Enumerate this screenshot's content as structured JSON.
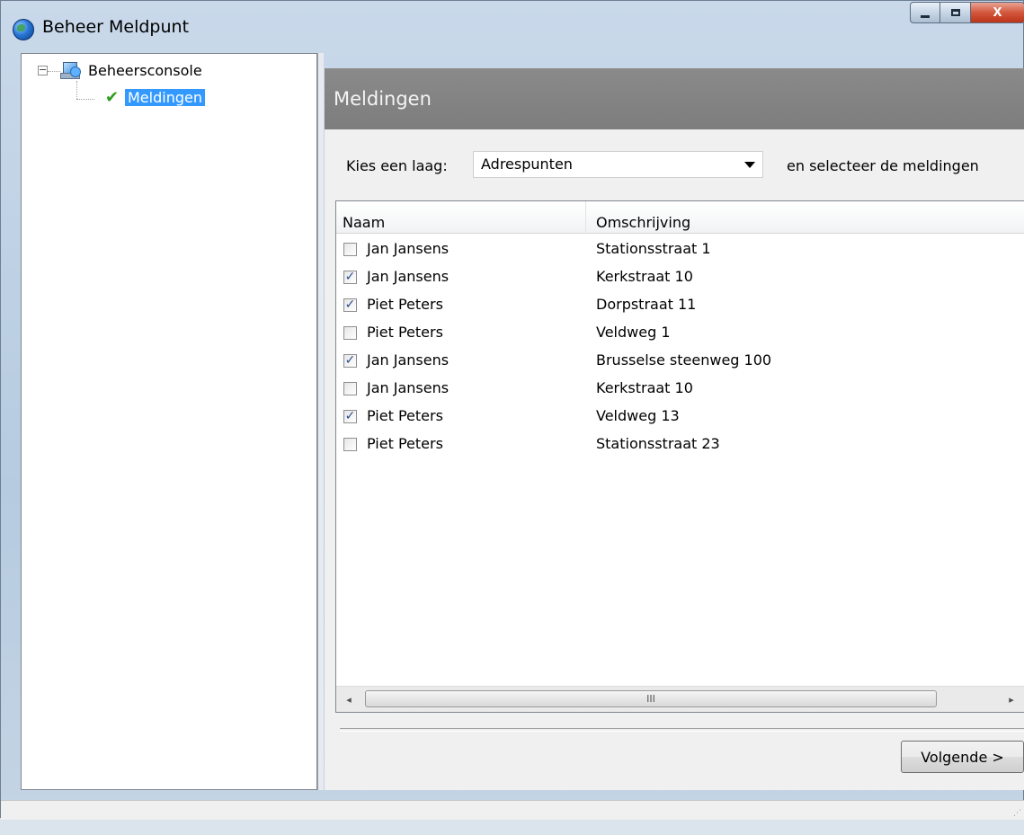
{
  "window": {
    "title": "Beheer Meldpunt",
    "close_glyph": "X"
  },
  "tree": {
    "root_label": "Beheersconsole",
    "root_expander": "−",
    "child_label": "Meldingen"
  },
  "panel": {
    "header": "Meldingen",
    "layer_label": "Kies een laag:",
    "layer_value": "Adrespunten",
    "select_hint": "en selecteer de meldingen"
  },
  "list": {
    "columns": [
      "Naam",
      "Omschrijving"
    ],
    "rows": [
      {
        "checked": false,
        "naam": "Jan Jansens",
        "omschrijving": "Stationsstraat 1"
      },
      {
        "checked": true,
        "naam": "Jan Jansens",
        "omschrijving": "Kerkstraat 10"
      },
      {
        "checked": true,
        "naam": "Piet Peters",
        "omschrijving": "Dorpstraat 11"
      },
      {
        "checked": false,
        "naam": "Piet Peters",
        "omschrijving": "Veldweg 1"
      },
      {
        "checked": true,
        "naam": "Jan Jansens",
        "omschrijving": "Brusselse steenweg 100"
      },
      {
        "checked": false,
        "naam": "Jan Jansens",
        "omschrijving": "Kerkstraat 10"
      },
      {
        "checked": true,
        "naam": "Piet Peters",
        "omschrijving": "Veldweg 13"
      },
      {
        "checked": false,
        "naam": "Piet Peters",
        "omschrijving": "Stationsstraat 23"
      }
    ],
    "scroll_left": "◂",
    "scroll_thumb": "III",
    "scroll_right": "▸"
  },
  "buttons": {
    "next_label": "Volgende >"
  },
  "colors": {
    "selection": "#3399ff",
    "header_band": "#808080",
    "check": "#2e9e1e"
  }
}
